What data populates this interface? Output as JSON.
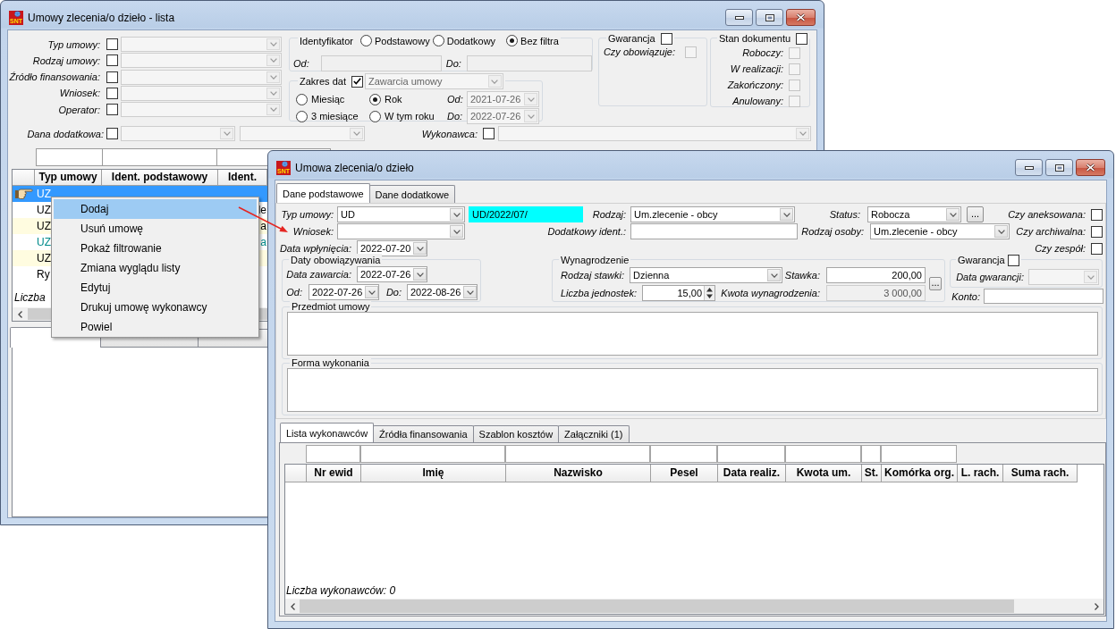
{
  "list_window": {
    "title": "Umowy zlecenia/o dzieło - lista",
    "logo_text": "SNT",
    "filters": [
      {
        "label": "Typ umowy:",
        "checked": false,
        "disabled": true
      },
      {
        "label": "Rodzaj umowy:",
        "checked": false,
        "disabled": true
      },
      {
        "label": "Źródło finansowania:",
        "checked": false,
        "disabled": true
      },
      {
        "label": "Wniosek:",
        "checked": false,
        "disabled": true
      },
      {
        "label": "Operator:",
        "checked": false,
        "disabled": true
      }
    ],
    "identifier": {
      "legend": "Identyfikator",
      "options": [
        {
          "label": "Podstawowy",
          "selected": false
        },
        {
          "label": "Dodatkowy",
          "selected": false
        },
        {
          "label": "Bez filtra",
          "selected": true
        }
      ],
      "from_label": "Od:",
      "to_label": "Do:",
      "disabled": true
    },
    "date_range": {
      "legend": "Zakres dat",
      "checked": true,
      "date_type": "Zawarcia umowy",
      "options": [
        {
          "label": "Miesiąc",
          "selected": false
        },
        {
          "label": "Rok",
          "selected": true
        },
        {
          "label": "3 miesiące",
          "selected": false
        },
        {
          "label": "W tym roku",
          "selected": false
        }
      ],
      "from": {
        "label": "Od:",
        "value": "2021-07-26"
      },
      "to": {
        "label": "Do:",
        "value": "2022-07-26"
      },
      "disabled": true
    },
    "guarantee": {
      "legend": "Gwarancja",
      "checked": false,
      "items": [
        {
          "label": "Czy obowiązuje:",
          "checked": false,
          "disabled": true
        }
      ]
    },
    "document_state": {
      "legend": "Stan dokumentu",
      "checked": false,
      "items": [
        {
          "label": "Roboczy:",
          "checked": false,
          "disabled": true
        },
        {
          "label": "W realizacji:",
          "checked": false,
          "disabled": true
        },
        {
          "label": "Zakończony:",
          "checked": false,
          "disabled": true
        },
        {
          "label": "Anulowany:",
          "checked": false,
          "disabled": true
        }
      ]
    },
    "extra_data": {
      "label": "Dana dodatkowa:",
      "checked": false,
      "disabled": true
    },
    "contractor": {
      "label": "Wykonawca:",
      "checked": false,
      "disabled": true
    },
    "table": {
      "columns": [
        "Typ umowy",
        "Ident. podstawowy",
        "Ident."
      ],
      "rows": [
        {
          "typ_umowy": "UZ",
          "selected": true
        },
        {
          "typ_umowy": "UZ",
          "column_3": "le",
          "selected": false,
          "color": "#000000"
        },
        {
          "typ_umowy": "UZ",
          "column_3": "a",
          "selected": false,
          "color": "#000000"
        },
        {
          "typ_umowy": "UZ",
          "column_3": "a",
          "selected": false,
          "color": "#008b8b"
        },
        {
          "typ_umowy": "UZ",
          "selected": false,
          "color": "#000000"
        },
        {
          "typ_umowy": "Ry",
          "selected": false,
          "color": "#000000"
        }
      ],
      "footer": "Liczba"
    },
    "tabs": [
      {
        "selected": true
      },
      {
        "selected": false
      },
      {
        "selected": false
      }
    ]
  },
  "context_menu": {
    "items": [
      {
        "label": "Dodaj",
        "selected": true
      },
      {
        "label": "Usuń umowę",
        "selected": false
      },
      {
        "label": "Pokaż filtrowanie",
        "selected": false
      },
      {
        "label": "Zmiana wyglądu listy",
        "selected": false
      },
      {
        "label": "Edytuj",
        "selected": false
      },
      {
        "label": "Drukuj umowę wykonawcy",
        "selected": false
      },
      {
        "label": "Powiel",
        "selected": false
      }
    ]
  },
  "dialog": {
    "title": "Umowa zlecenia/o dzieło",
    "logo_text": "SNT",
    "tabs": [
      {
        "label": "Dane podstawowe",
        "selected": true
      },
      {
        "label": "Dane dodatkowe",
        "selected": false
      }
    ],
    "contract_type": {
      "label": "Typ umowy:",
      "value": "UD"
    },
    "identifier": {
      "value": "UD/2022/07/",
      "highlighted": true
    },
    "kind": {
      "label": "Rodzaj:",
      "value": "Um.zlecenie - obcy"
    },
    "status": {
      "label": "Status:",
      "value": "Robocza",
      "button": "..."
    },
    "application": {
      "label": "Wniosek:"
    },
    "extra_ident": {
      "label": "Dodatkowy ident.:"
    },
    "person_kind": {
      "label": "Rodzaj osoby:",
      "value": "Um.zlecenie - obcy"
    },
    "received_date": {
      "label": "Data wpłynięcia:",
      "value": "2022-07-20"
    },
    "flags": [
      {
        "label": "Czy aneksowana:",
        "checked": false
      },
      {
        "label": "Czy archiwalna:",
        "checked": false
      },
      {
        "label": "Czy zespół:",
        "checked": false
      }
    ],
    "validity": {
      "legend": "Daty obowiązywania",
      "concluded": {
        "label": "Data zawarcia:",
        "value": "2022-07-26"
      },
      "from": {
        "label": "Od:",
        "value": "2022-07-26"
      },
      "to": {
        "label": "Do:",
        "value": "2022-08-26"
      }
    },
    "remuneration": {
      "legend": "Wynagrodzenie",
      "rate_type": {
        "label": "Rodzaj stawki:",
        "value": "Dzienna"
      },
      "rate": {
        "label": "Stawka:",
        "value": "200,00"
      },
      "units": {
        "label": "Liczba jednostek:",
        "value": "15,00"
      },
      "amount": {
        "label": "Kwota wynagrodzenia:",
        "value": "3 000,00",
        "disabled": true
      },
      "button": "..."
    },
    "guarantee": {
      "legend": "Gwarancja",
      "checked": false,
      "date": {
        "label": "Data gwarancji:",
        "disabled": true
      }
    },
    "account": {
      "label": "Konto:"
    },
    "subject": {
      "legend": "Przedmiot umowy"
    },
    "execution_form": {
      "legend": "Forma wykonania"
    },
    "bottom_tabs": [
      {
        "label": "Lista wykonawców",
        "selected": true
      },
      {
        "label": "Źródła finansowania",
        "selected": false
      },
      {
        "label": "Szablon kosztów",
        "selected": false
      },
      {
        "label": "Załączniki (1)",
        "selected": false
      }
    ],
    "table": {
      "columns": [
        "Nr ewid",
        "Imię",
        "Nazwisko",
        "Pesel",
        "Data realiz.",
        "Kwota um.",
        "St.",
        "Komórka org.",
        "L. rach.",
        "Suma rach."
      ],
      "footer": "Liczba wykonawców: 0"
    }
  }
}
